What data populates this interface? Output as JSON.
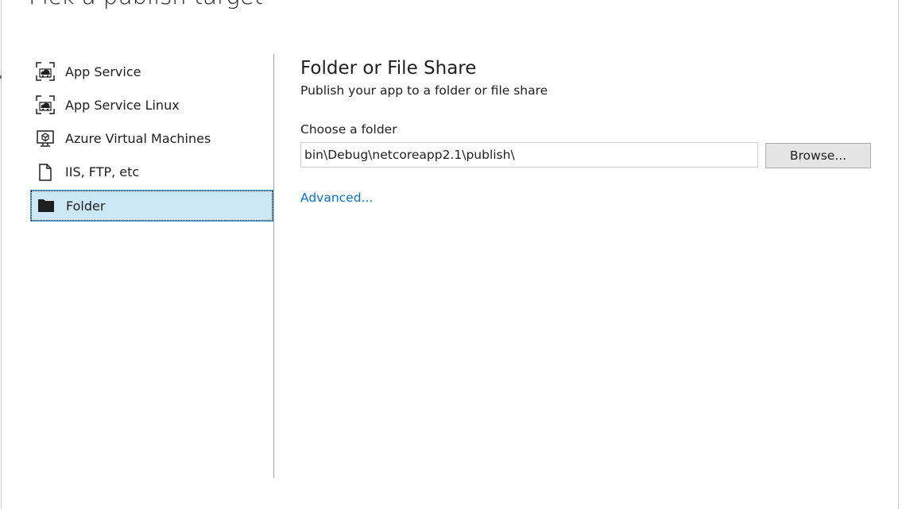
{
  "page": {
    "title": "Pick a publish target"
  },
  "targets": [
    {
      "label": "App Service",
      "icon": "app-service-icon",
      "selected": false
    },
    {
      "label": "App Service Linux",
      "icon": "app-service-linux-icon",
      "selected": false
    },
    {
      "label": "Azure Virtual Machines",
      "icon": "virtual-machine-icon",
      "selected": false
    },
    {
      "label": "IIS, FTP, etc",
      "icon": "document-icon",
      "selected": false
    },
    {
      "label": "Folder",
      "icon": "folder-icon",
      "selected": true
    }
  ],
  "detail": {
    "title": "Folder or File Share",
    "subtitle": "Publish your app to a folder or file share",
    "folder_label": "Choose a folder",
    "folder_value": "bin\\Debug\\netcoreapp2.1\\publish\\",
    "browse_label": "Browse...",
    "advanced_label": "Advanced..."
  },
  "colors": {
    "selection_background": "#cce8f6",
    "selection_border": "#3399dd",
    "link": "#0e70c0",
    "button_background": "#e5e5e5"
  }
}
